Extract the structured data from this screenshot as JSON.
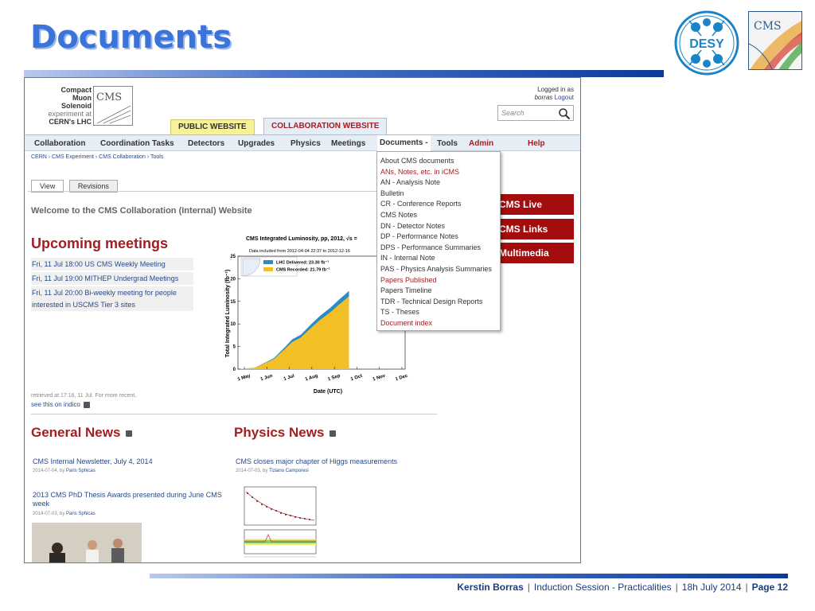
{
  "slide": {
    "title": "Documents",
    "desy_logo_text": "DESY",
    "cms_logo_text": "CMS",
    "footer": {
      "author": "Kerstin Borras",
      "session": "Induction Session - Practicalities",
      "date": "18h  July 2014",
      "page": "Page 12"
    }
  },
  "site": {
    "logo_lines": [
      "Compact",
      "Muon",
      "Solenoid",
      "experiment at",
      "CERN's LHC"
    ],
    "logo_box": "CMS",
    "logged_in": "Logged in as",
    "user": "borras",
    "logout": "Logout",
    "search_placeholder": "Search",
    "tab_public": "PUBLIC WEBSITE",
    "tab_collab": "COLLABORATION WEBSITE",
    "nav": [
      "Collaboration",
      "Coordination Tasks",
      "Detectors",
      "Upgrades",
      "Physics",
      "Meetings",
      "Documents -",
      "Tools",
      "Admin",
      "Help"
    ],
    "breadcrumb": "CERN › CMS Experiment › CMS Collaboration › Tools",
    "view_tabs": [
      "View",
      "Revisions"
    ],
    "welcome": "Welcome to the CMS Collaboration (Internal) Website",
    "meetings_title": "Upcoming meetings",
    "meetings": [
      "Fri, 11 Jul 18:00 US CMS Weekly Meeting",
      "Fri, 11 Jul 19:00 MITHEP Undergrad Meetings",
      "Fri, 11 Jul 20:00 Bi-weekly meeting for people",
      "interested in USCMS Tier 3 sites"
    ],
    "retrieved": "retrieved at 17:16, 11 Jul. For more recent,",
    "see_indico": "see this on indico",
    "side_buttons": [
      "CMS Live",
      "CMS Links",
      "Multimedia"
    ],
    "documents_menu": [
      {
        "label": "About CMS documents",
        "highlight": false
      },
      {
        "label": "ANs, Notes, etc. in iCMS",
        "highlight": true
      },
      {
        "label": "AN - Analysis Note",
        "highlight": false
      },
      {
        "label": "Bulletin",
        "highlight": false
      },
      {
        "label": "CR - Conference Reports",
        "highlight": false
      },
      {
        "label": "CMS Notes",
        "highlight": false
      },
      {
        "label": "DN - Detector Notes",
        "highlight": false
      },
      {
        "label": "DP - Performance Notes",
        "highlight": false
      },
      {
        "label": "DPS - Performance Summaries",
        "highlight": false
      },
      {
        "label": "IN - Internal Note",
        "highlight": false
      },
      {
        "label": "PAS - Physics Analysis Summaries",
        "highlight": false
      },
      {
        "label": "Papers Published",
        "highlight": true
      },
      {
        "label": "Papers Timeline",
        "highlight": false
      },
      {
        "label": "TDR - Technical Design Reports",
        "highlight": false
      },
      {
        "label": "TS - Theses",
        "highlight": false
      },
      {
        "label": "Document index",
        "highlight": true
      }
    ],
    "general_news_title": "General News",
    "physics_news_title": "Physics News",
    "general_news": [
      {
        "title": "CMS Internal Newsletter, July 4, 2014",
        "date": "2014-07-04, by",
        "author": "Paris Sphicas"
      },
      {
        "title": "2013 CMS PhD Thesis Awards presented during June CMS week",
        "date": "2014-07-03, by",
        "author": "Paris Sphicas"
      }
    ],
    "physics_news": [
      {
        "title": "CMS closes major chapter of Higgs measurements",
        "date": "2014-07-03, by",
        "author": "Tiziano Camporesi"
      }
    ]
  },
  "chart_data": {
    "type": "area",
    "title": "CMS Integrated Luminosity, pp, 2012, √s = ",
    "subtitle": "Data included from 2012-04-04 22:37 to 2012-12-16",
    "xlabel": "Date (UTC)",
    "ylabel": "Total Integrated Luminosity (fb⁻¹)",
    "x_ticks": [
      "1 May",
      "1 Jun",
      "1 Jul",
      "1 Aug",
      "1 Sep",
      "1 Oct",
      "1 Nov",
      "1 Dec"
    ],
    "y_ticks": [
      0,
      5,
      10,
      15,
      20,
      25
    ],
    "ylim": [
      0,
      25
    ],
    "series": [
      {
        "name": "LHC Delivered: 23.30 fb⁻¹",
        "color": "#2b8cc4",
        "x": [
          "2012-04-04",
          "2012-05-01",
          "2012-06-01",
          "2012-06-20",
          "2012-07-01",
          "2012-07-15",
          "2012-08-01",
          "2012-08-15",
          "2012-09-01",
          "2012-09-15",
          "2012-10-01"
        ],
        "values": [
          0,
          0.3,
          2.4,
          5.0,
          6.6,
          7.6,
          10.0,
          11.8,
          13.6,
          15.4,
          17.3
        ]
      },
      {
        "name": "CMS Recorded: 21.79 fb⁻¹",
        "color": "#f2bf27",
        "x": [
          "2012-04-04",
          "2012-05-01",
          "2012-06-01",
          "2012-06-20",
          "2012-07-01",
          "2012-07-15",
          "2012-08-01",
          "2012-08-15",
          "2012-09-01",
          "2012-09-15",
          "2012-10-01"
        ],
        "values": [
          0,
          0.3,
          2.2,
          4.6,
          6.0,
          7.0,
          9.2,
          10.9,
          12.6,
          14.3,
          16.1
        ]
      }
    ]
  }
}
